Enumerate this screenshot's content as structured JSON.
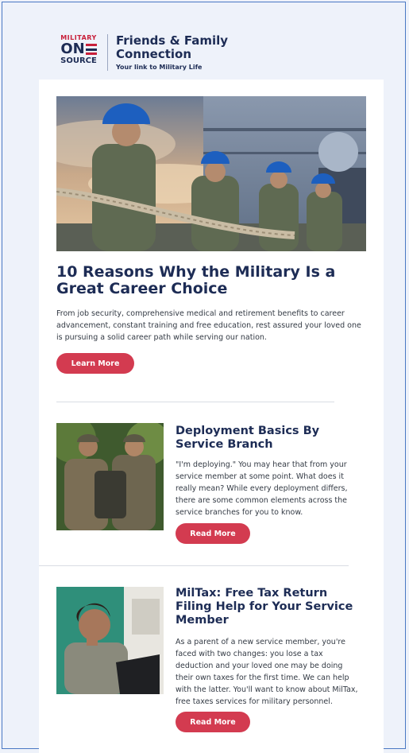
{
  "brand": {
    "military": "MILITARY",
    "one": "ON",
    "source": "SOURCE",
    "title_line1": "Friends & Family",
    "title_line2": "Connection",
    "tagline": "Your link to Military Life",
    "colors": {
      "navy": "#1d2c55",
      "red": "#c8203a",
      "button": "#d33b50"
    }
  },
  "hero": {
    "image": "sailors-pulling-rope-photo",
    "title": "10 Reasons Why the Military Is a Great Career Choice",
    "description": "From job security, comprehensive medical and retirement benefits to career advancement, constant training and free education, rest assured your loved one is pursuing a solid career path while serving our nation.",
    "button": "Learn More"
  },
  "articles": [
    {
      "image": "soldiers-in-field-photo",
      "title": "Deployment Basics By Service Branch",
      "body": "\"I'm deploying.\" You may hear that from your service member at some point. What does it really mean? While every deployment differs, there are some common elements across the service branches for you to know.",
      "button": "Read More"
    },
    {
      "image": "airman-at-laptop-photo",
      "title": "MilTax: Free Tax Return Filing Help for Your Service Member",
      "body": "As a parent of a new service member, you're faced with two changes: you lose a tax deduction and your loved one may be doing their own taxes for the first time. We can help with the latter. You'll want to know about MilTax, free taxes services for military personnel.",
      "button": "Read More"
    }
  ]
}
